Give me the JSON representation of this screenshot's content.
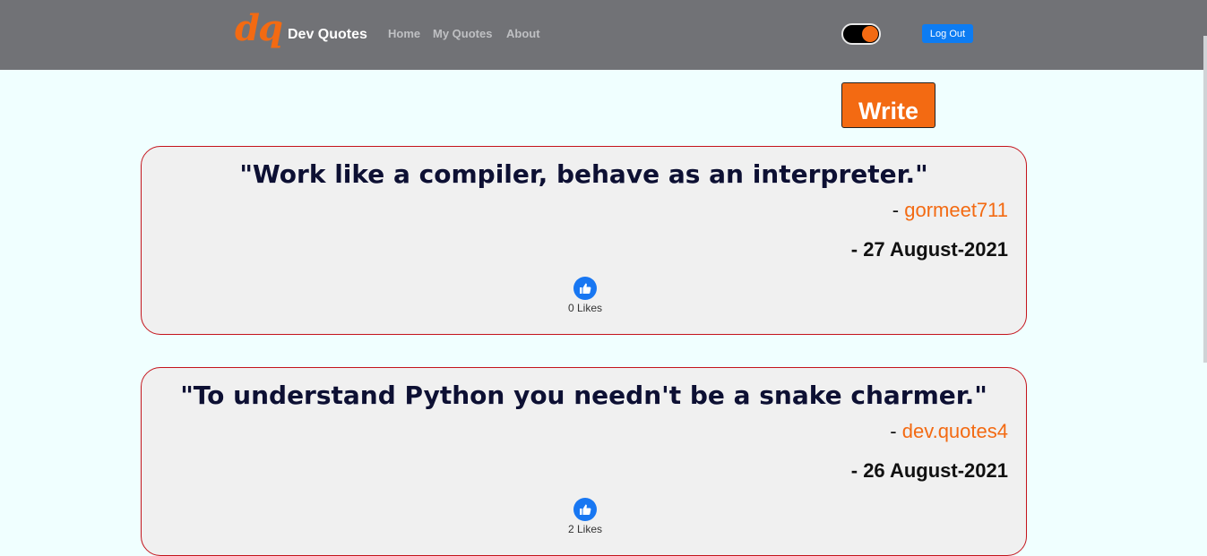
{
  "header": {
    "logo": "dq",
    "brand": "Dev Quotes",
    "nav": [
      "Home",
      "My Quotes",
      "About"
    ],
    "logout_label": "Log Out"
  },
  "write_label": "Write",
  "quotes": [
    {
      "text": "\"Work like a compiler, behave as an interpreter.\"",
      "author": "gormeet711",
      "date": "- 27 August-2021",
      "likes": "0 Likes"
    },
    {
      "text": "\"To understand Python you needn't be a snake charmer.\"",
      "author": "dev.quotes4",
      "date": "- 26 August-2021",
      "likes": "2 Likes"
    }
  ],
  "colors": {
    "accent": "#f36a12",
    "nav_bg": "#717276",
    "like_blue": "#1877f2"
  },
  "icons": {
    "like": "thumbs-up-icon"
  }
}
